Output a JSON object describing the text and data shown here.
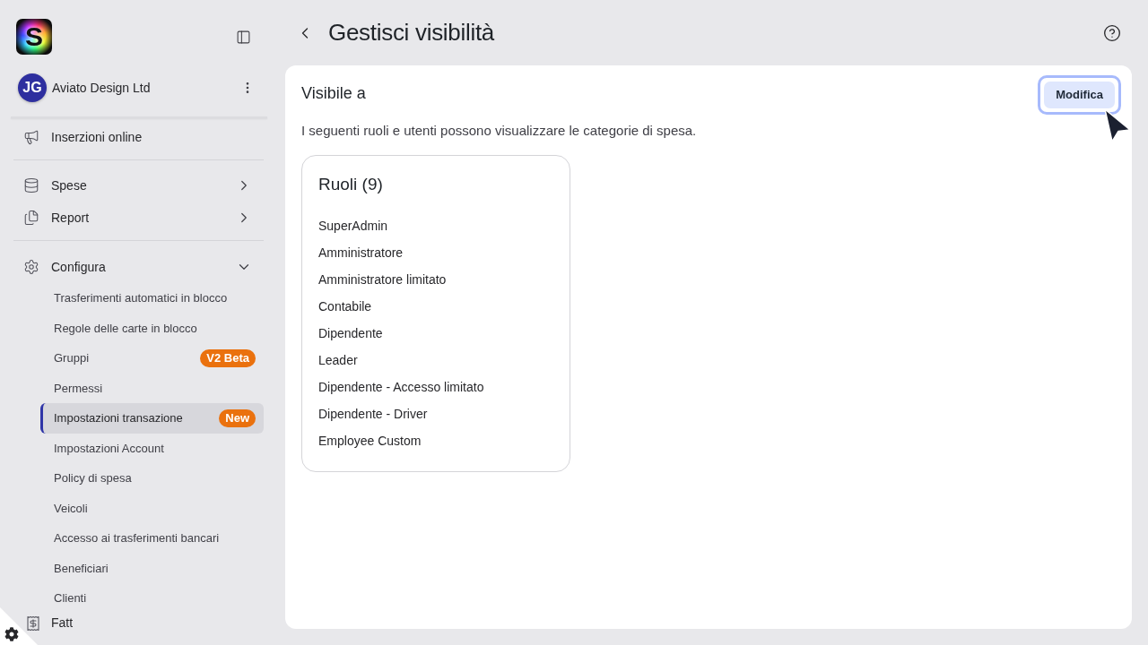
{
  "sidebar": {
    "logo": {
      "text": "S"
    },
    "account": {
      "initials": "JG",
      "name": "Aviato Design Ltd"
    },
    "sections": [
      {
        "items": [
          {
            "label": "Inserzioni online"
          }
        ]
      },
      {
        "items": [
          {
            "label": "Spese",
            "expanded": false
          },
          {
            "label": "Report",
            "expanded": false
          }
        ]
      },
      {
        "items": [
          {
            "label": "Configura",
            "expanded": true,
            "children": [
              {
                "label": "Trasferimenti automatici in blocco",
                "selected": false
              },
              {
                "label": "Regole delle carte in blocco",
                "selected": false
              },
              {
                "label": "Gruppi",
                "selected": false,
                "badge": "V2 Beta"
              },
              {
                "label": "Permessi",
                "selected": false
              },
              {
                "label": "Impostazioni transazione",
                "selected": true,
                "badge": "New"
              },
              {
                "label": "Impostazioni Account",
                "selected": false
              },
              {
                "label": "Policy di spesa",
                "selected": false
              },
              {
                "label": "Veicoli",
                "selected": false
              },
              {
                "label": "Accesso ai trasferimenti bancari",
                "selected": false
              },
              {
                "label": "Beneficiari",
                "selected": false
              },
              {
                "label": "Clienti",
                "selected": false
              }
            ]
          },
          {
            "label": "Fatt"
          }
        ]
      }
    ]
  },
  "header": {
    "title": "Gestisci visibilità"
  },
  "panel": {
    "title": "Visibile a",
    "edit_button": {
      "label": "Modifica",
      "focused": true
    },
    "description": "I seguenti ruoli e utenti possono visualizzare le categorie di spesa.",
    "roles": {
      "title": "Ruoli (9)",
      "items": [
        "SuperAdmin",
        "Amministratore",
        "Amministratore limitato",
        "Contabile",
        "Dipendente",
        "Leader",
        "Dipendente - Accesso limitato",
        "Dipendente - Driver",
        "Employee Custom"
      ]
    }
  }
}
